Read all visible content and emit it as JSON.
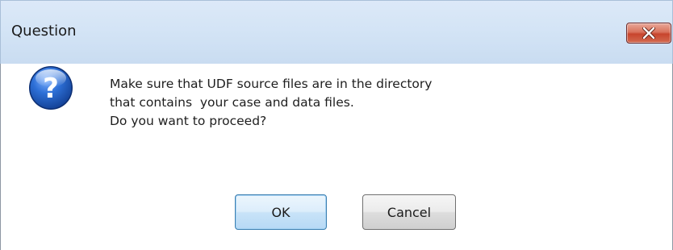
{
  "window": {
    "title": "Question",
    "close_icon": "close-icon"
  },
  "dialog": {
    "icon": "question-icon",
    "message_lines": [
      "Make sure that UDF source files are in the directory",
      "that contains  your case and data files.",
      "Do you want to proceed?"
    ]
  },
  "buttons": {
    "ok_label": "OK",
    "cancel_label": "Cancel"
  },
  "colors": {
    "titlebar": "#d2e3f5",
    "close_button": "#c7452d",
    "ok_border": "#3c7fb1",
    "icon_blue": "#1f56b5"
  }
}
